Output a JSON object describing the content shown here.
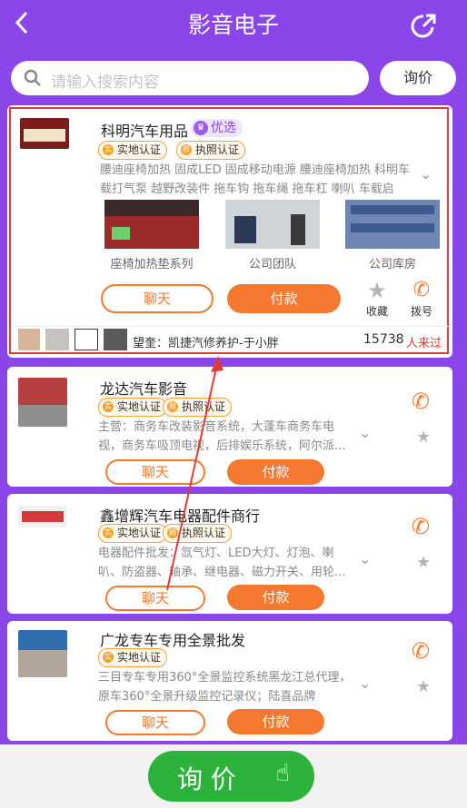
{
  "header": {
    "title": "影音电子",
    "back_icon": "chevron-left-icon",
    "share_icon": "share-icon"
  },
  "search": {
    "placeholder": "请输入搜索内容",
    "inquiry_label": "询价"
  },
  "featured": {
    "name": "科明汽车用品",
    "tag": "优选",
    "badges": [
      "实地认证",
      "执照认证"
    ],
    "description": "腰迪座椅加热 固成LED 固成移动电源 腰迪座椅加热 科明车载打气泵 越野改装件 拖车钩 拖车绳 拖车杠 喇叭 车载启动...",
    "photos": [
      "座椅加热垫系列",
      "公司团队",
      "公司库房"
    ],
    "chat_label": "聊天",
    "pay_label": "付款",
    "favorite_label": "收藏",
    "dial_label": "拨号",
    "visitor_text": "望奎：凯捷汽修养护-于小胖",
    "visitor_count": "15738",
    "visitor_suffix": "人来过"
  },
  "listings": [
    {
      "name": "龙达汽车影音",
      "badges": [
        "实地认证",
        "执照认证"
      ],
      "description": "主营：商务车改装影音系统，大蓬车商务车电视，商务车吸顶电视，后排娱乐系统，阿尔派...",
      "chat_label": "聊天",
      "pay_label": "付款"
    },
    {
      "name": "鑫增辉汽车电器配件商行",
      "badges": [
        "实地认证",
        "执照认证"
      ],
      "description": "电器配件批发：氙气灯、LED大灯、灯泡、喇叭、防盗器、轴承、继电器、磁力开关、用轮...",
      "chat_label": "聊天",
      "pay_label": "付款"
    },
    {
      "name": "广龙专车专用全景批发",
      "badges": [
        "实地认证"
      ],
      "description": "三目专车专用360°全景监控系统黑龙江总代理，原车360°全景升级监控记录仪；陆喜品牌360°...",
      "chat_label": "聊天",
      "pay_label": "付款"
    }
  ],
  "bottom": {
    "inquiry_label": "询 价"
  },
  "colors": {
    "primary": "#8a46e8",
    "accent": "#f4782e",
    "green": "#2cb33b",
    "highlight": "#e53935"
  }
}
